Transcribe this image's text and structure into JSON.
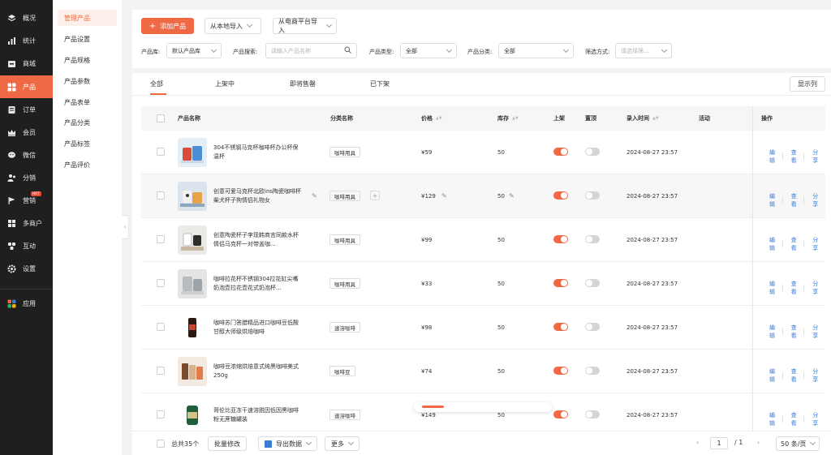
{
  "sidebar": {
    "items": [
      {
        "label": "概况",
        "icon": "layers-icon"
      },
      {
        "label": "统计",
        "icon": "chart-icon"
      },
      {
        "label": "商城",
        "icon": "store-icon"
      },
      {
        "label": "产品",
        "icon": "apps-icon"
      },
      {
        "label": "订单",
        "icon": "order-icon"
      },
      {
        "label": "会员",
        "icon": "crown-icon"
      },
      {
        "label": "微信",
        "icon": "wechat-icon"
      },
      {
        "label": "分销",
        "icon": "distribution-icon"
      },
      {
        "label": "营销",
        "icon": "flag-icon"
      },
      {
        "label": "多商户",
        "icon": "merchant-icon"
      },
      {
        "label": "互动",
        "icon": "interaction-icon"
      },
      {
        "label": "设置",
        "icon": "gear-icon"
      },
      {
        "label": "应用",
        "icon": "app-grid-icon"
      }
    ],
    "hot_badge": "HOT",
    "accent": "#ef6a44"
  },
  "submenu": {
    "items": [
      "管理产品",
      "产品设置",
      "产品规格",
      "产品参数",
      "产品表单",
      "产品分类",
      "产品标签",
      "产品评价"
    ]
  },
  "toolbar": {
    "add_label": "添加产品",
    "local_import": "从本地导入",
    "platform_import": "从电商平台导入"
  },
  "filters": {
    "library_label": "产品库:",
    "library_value": "默认产品库",
    "search_label": "产品搜索:",
    "search_placeholder": "请输入产品名称",
    "type_label": "产品类型:",
    "type_value": "全部",
    "category_label": "产品分类:",
    "category_value": "全部",
    "filter_label": "筛选方式:",
    "filter_placeholder": "请选择筛..."
  },
  "tabs": [
    "全部",
    "上架中",
    "即将售罄",
    "已下架"
  ],
  "columns_button": "显示列",
  "table": {
    "headers": {
      "name": "产品名称",
      "category": "分类名称",
      "price": "价格",
      "stock": "库存",
      "listed": "上架",
      "pinned": "置顶",
      "entered": "录入时间",
      "activity": "活动",
      "actions": "操作"
    },
    "action_labels": [
      "编辑",
      "查看",
      "分享"
    ],
    "rows": [
      {
        "name": "304不锈钢马克杯咖啡杯办公杯保温杯",
        "category": "咖啡用具",
        "price": "¥59",
        "stock": "50",
        "listed": true,
        "pinned": false,
        "date": "2024-08-27 23:57"
      },
      {
        "name": "创意可爱马克杯北欧ins陶瓷咖啡杯柴犬杯子狗情侣礼物女",
        "category": "咖啡用具",
        "price": "¥129",
        "stock": "50",
        "listed": true,
        "pinned": false,
        "date": "2024-08-27 23:57"
      },
      {
        "name": "创意陶瓷杯子李现韩商言同款水杯情侣马克杯一对带盖咖...",
        "category": "咖啡用具",
        "price": "¥99",
        "stock": "50",
        "listed": true,
        "pinned": false,
        "date": "2024-08-27 23:57"
      },
      {
        "name": "咖啡拉花杯不锈钢304拉花缸尖嘴奶泡壶拉花壶花式奶泡杯...",
        "category": "咖啡用具",
        "price": "¥33",
        "stock": "50",
        "listed": true,
        "pinned": false,
        "date": "2024-08-27 23:57"
      },
      {
        "name": "咖啡苏门答腊精品进口咖啡豆低酸甘醇大师级烘焙咖啡",
        "category": "速溶咖啡",
        "price": "¥98",
        "stock": "50",
        "listed": true,
        "pinned": false,
        "date": "2024-08-27 23:57"
      },
      {
        "name": "咖啡豆浓缩烘焙意式纯黑咖啡美式250g",
        "category": "咖啡豆",
        "price": "¥74",
        "stock": "50",
        "listed": true,
        "pinned": false,
        "date": "2024-08-27 23:57"
      },
      {
        "name": "哥伦比亚冻干速溶脱因低因黑咖啡粉无蔗糖罐装",
        "category": "速溶咖啡",
        "price": "¥149",
        "stock": "50",
        "listed": true,
        "pinned": false,
        "date": "2024-08-27 23:57"
      }
    ]
  },
  "loading_progress": 0.18,
  "footer": {
    "total": "总共35个",
    "batch_edit": "批量修改",
    "export": "导出数据",
    "more": "更多",
    "current_page": "1",
    "total_pages": "/ 1",
    "page_size": "50 条/页"
  }
}
